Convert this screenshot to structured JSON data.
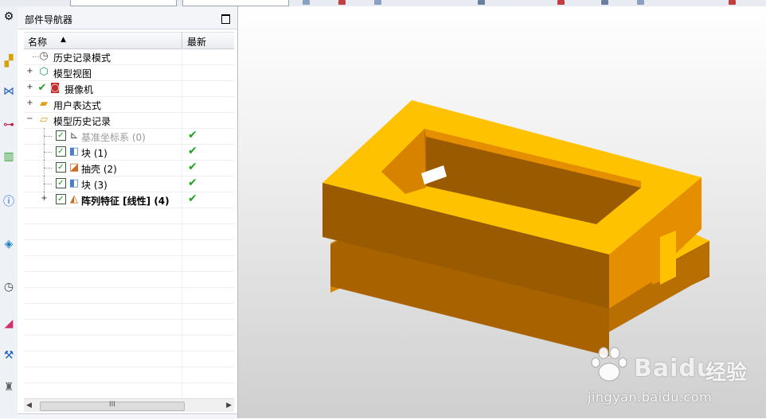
{
  "navigator": {
    "title": "部件导航器",
    "columns": {
      "name": "名称",
      "latest": "最新"
    },
    "rows": [
      {
        "label": "历史记录模式",
        "icon": "clock-icon"
      },
      {
        "label": "模型视图",
        "icon": "model-views-icon"
      },
      {
        "label": "摄像机",
        "icon": "camera-icon"
      },
      {
        "label": "用户表达式",
        "icon": "folder-icon"
      },
      {
        "label": "模型历史记录",
        "icon": "folder-open-icon"
      },
      {
        "label": "基准坐标系 (0)",
        "icon": "datum-csys-icon",
        "latest": "✔"
      },
      {
        "label": "块 (1)",
        "icon": "block-icon",
        "latest": "✔"
      },
      {
        "label": "抽壳 (2)",
        "icon": "shell-icon",
        "latest": "✔"
      },
      {
        "label": "块 (3)",
        "icon": "block-icon",
        "latest": "✔"
      },
      {
        "label": "阵列特征 [线性] (4)",
        "icon": "pattern-feature-icon",
        "latest": "✔"
      }
    ],
    "scroll_grip": "III"
  },
  "watermark": {
    "brand": "Baidu",
    "brand_cn": "经验",
    "url": "jingyan.baidu.com"
  },
  "colors": {
    "part_top": "#ffc200",
    "part_side": "#e58e00",
    "part_dark": "#a86200",
    "check_green": "#22a322"
  }
}
